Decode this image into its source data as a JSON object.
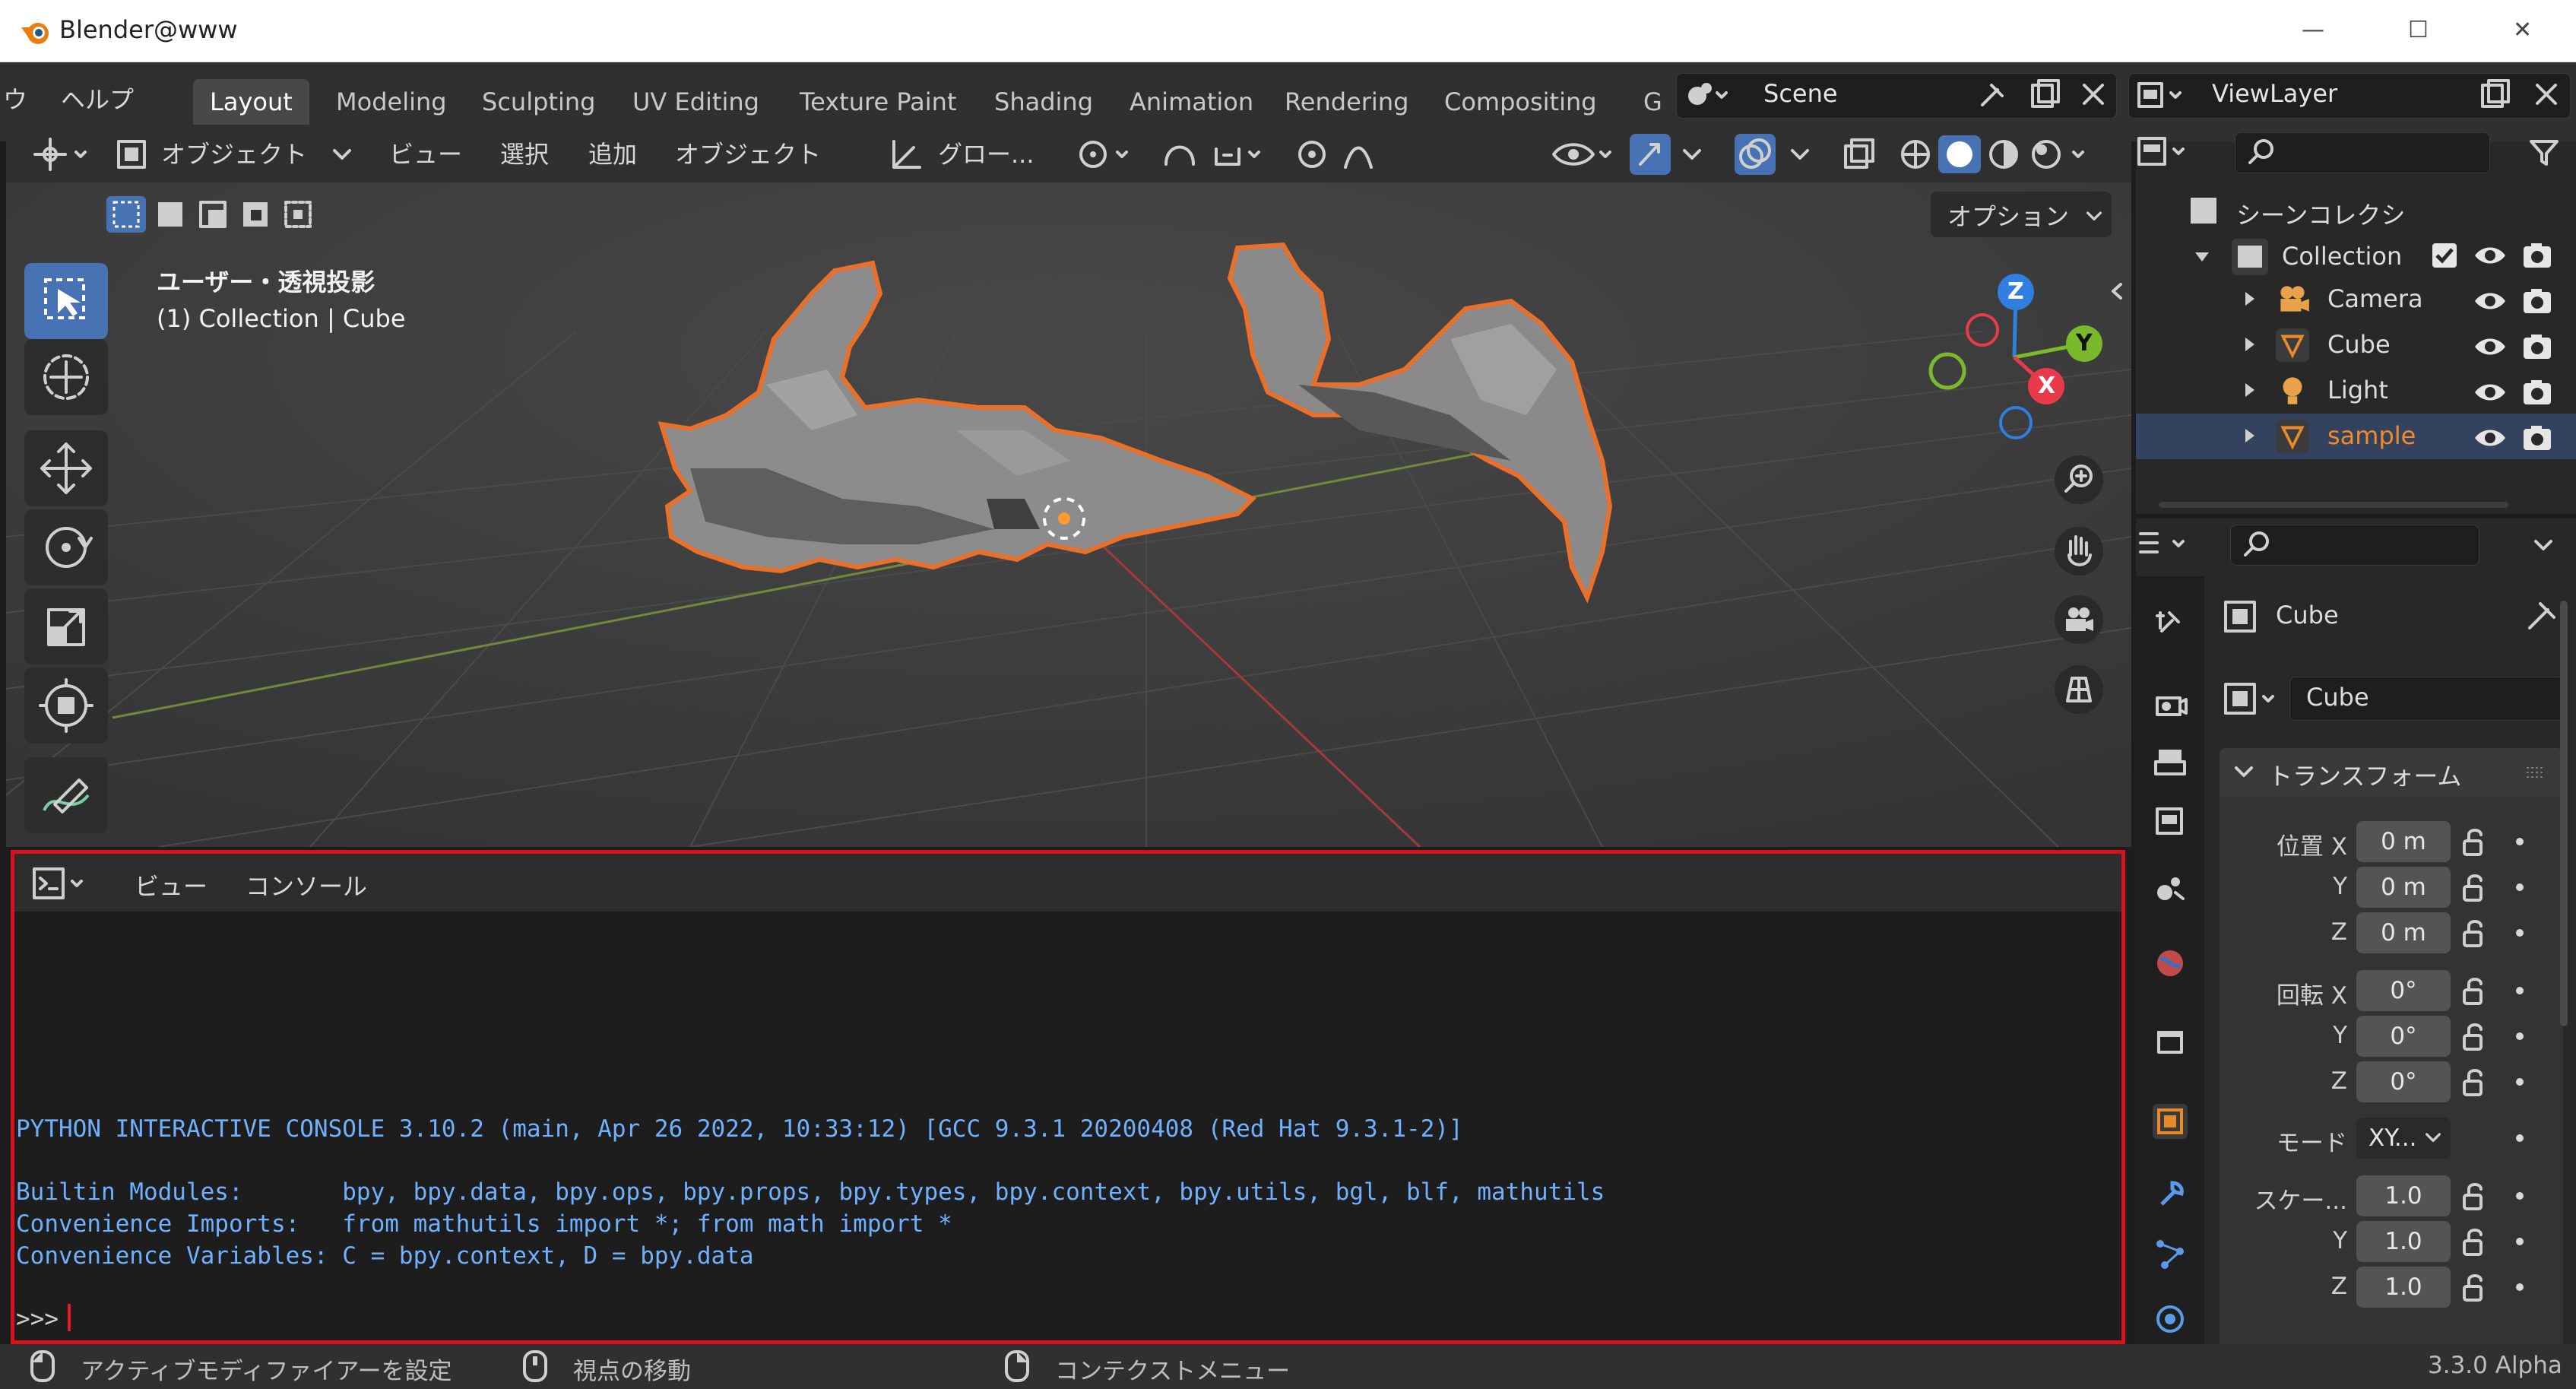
{
  "window": {
    "title": "Blender@www",
    "minimize": "—",
    "maximize": "☐",
    "close": "✕"
  },
  "menus": {
    "partial_left": "ウ",
    "help": "ヘルプ"
  },
  "workspaces": [
    "Layout",
    "Modeling",
    "Sculpting",
    "UV Editing",
    "Texture Paint",
    "Shading",
    "Animation",
    "Rendering",
    "Compositing",
    "G"
  ],
  "scene": {
    "name": "Scene"
  },
  "viewlayer": {
    "name": "ViewLayer"
  },
  "viewport_header": {
    "mode": "オブジェクト",
    "view": "ビュー",
    "select": "選択",
    "add": "追加",
    "object": "オブジェクト",
    "orientation": "グロー...",
    "options": "オプション"
  },
  "viewport_info": {
    "line1": "ユーザー・透視投影",
    "line2": "(1) Collection | Cube"
  },
  "gizmo": {
    "x": "X",
    "y": "Y",
    "z": "Z"
  },
  "console": {
    "menu_view": "ビュー",
    "menu_console": "コンソール",
    "lines": [
      "PYTHON INTERACTIVE CONSOLE 3.10.2 (main, Apr 26 2022, 10:33:12) [GCC 9.3.1 20200408 (Red Hat 9.3.1-2)]",
      "",
      "Builtin Modules:       bpy, bpy.data, bpy.ops, bpy.props, bpy.types, bpy.context, bpy.utils, bgl, blf, mathutils",
      "Convenience Imports:   from mathutils import *; from math import *",
      "Convenience Variables: C = bpy.context, D = bpy.data"
    ],
    "prompt": ">>> "
  },
  "outliner": {
    "root": "シーンコレクシ",
    "collection": "Collection",
    "items": [
      {
        "name": "Camera",
        "icon": "camera-icon"
      },
      {
        "name": "Cube",
        "icon": "mesh-icon"
      },
      {
        "name": "Light",
        "icon": "light-icon"
      },
      {
        "name": "sample",
        "icon": "mesh-icon",
        "selected": true
      }
    ]
  },
  "properties": {
    "object_name": "Cube",
    "data_name": "Cube",
    "section": "トランスフォーム",
    "location": {
      "label": "位置 X",
      "x": "0 m",
      "y": "0 m",
      "z": "0 m"
    },
    "rotation": {
      "label": "回転 X",
      "x": "0°",
      "y": "0°",
      "z": "0°"
    },
    "mode": {
      "label": "モード",
      "value": "XY..."
    },
    "scale": {
      "label": "スケー...",
      "x": "1.0",
      "y": "1.0",
      "z": "1.0"
    },
    "axis_y": "Y",
    "axis_z": "Z"
  },
  "status": {
    "left": "アクティブモディファイアーを設定",
    "middle": "視点の移動",
    "right": "コンテクストメニュー",
    "version": "3.3.0 Alpha"
  },
  "colors": {
    "accent": "#4772b3",
    "outline": "#e8702a",
    "console_text": "#6fb0ff",
    "highlight_border": "#d8121b",
    "selected_text": "#f08a2a"
  }
}
